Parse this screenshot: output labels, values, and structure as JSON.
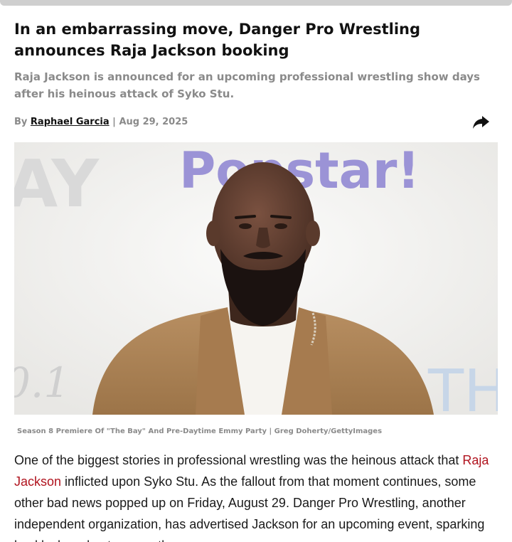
{
  "article": {
    "headline": "In an embarrassing move, Danger Pro Wrestling announces Raja Jackson booking",
    "subheadline": "Raja Jackson is announced for an upcoming professional wrestling show days after his heinous attack of Syko Stu.",
    "byline": {
      "prefix": "By ",
      "author": "Raphael Garcia",
      "separator": " | ",
      "date": "Aug 29, 2025"
    },
    "share_icon": "share-arrow-icon",
    "image": {
      "backdrop_text_left": "AY",
      "backdrop_text_main": "Popstar!",
      "backdrop_text_bottom_left": "0.1",
      "backdrop_text_bottom_right": "TH",
      "caption": "Season 8 Premiere Of \"The Bay\" And Pre-Daytime Emmy Party | Greg Doherty/GettyImages"
    },
    "body": {
      "part1": "One of the biggest stories in professional wrestling was the heinous attack that ",
      "link_text": "Raja Jackson",
      "part2": " inflicted upon Syko Stu. As the fallout from that moment continues, some other bad news popped up on Friday, August 29. Danger Pro Wrestling, another independent organization, has advertised Jackson for an upcoming event, sparking backlash and outrage on the"
    }
  },
  "colors": {
    "link": "#b0131e",
    "muted": "#8a8a8a",
    "text": "#1a1a1a",
    "backdrop_purple": "#9b93d6"
  }
}
